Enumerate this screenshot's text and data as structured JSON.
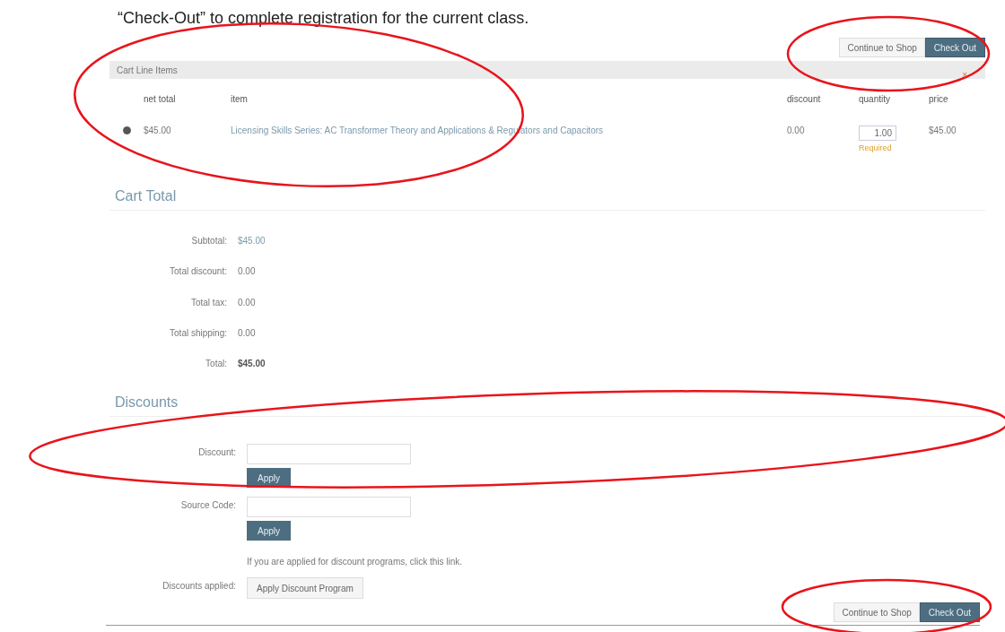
{
  "instruction": "“Check-Out” to complete registration for the current class.",
  "top_actions": [
    "Continue to Shop",
    "Check Out"
  ],
  "cart_line_items": {
    "title": "Cart Line Items",
    "remove_icon": "×",
    "columns": [
      "net total",
      "item",
      "discount",
      "quantity",
      "price"
    ],
    "rows": [
      {
        "selected": true,
        "net_total": "$45.00",
        "item": "Licensing Skills Series: AC Transformer Theory and Applications & Regulators and Capacitors",
        "discount": "0.00",
        "quantity": "1.00",
        "note": "Required",
        "price": "$45.00"
      }
    ]
  },
  "cart_total": {
    "title": "Cart Total",
    "rows": [
      {
        "label": "Subtotal:",
        "value": "$45.00",
        "kind": "link"
      },
      {
        "label": "Total discount:",
        "value": "0.00",
        "kind": "plain"
      },
      {
        "label": "Total tax:",
        "value": "0.00",
        "kind": "plain"
      },
      {
        "label": "Total shipping:",
        "value": "0.00",
        "kind": "plain"
      },
      {
        "label": "Total:",
        "value": "$45.00",
        "kind": "bold"
      }
    ]
  },
  "discounts": {
    "title": "Discounts",
    "fields": [
      {
        "label": "Discount:",
        "button": "Apply"
      },
      {
        "label": "Source Code:",
        "button": "Apply"
      }
    ],
    "note": "If you are applied for discount programs, click this link.",
    "applied_label": "Discounts applied:",
    "applied_button": "Apply Discount Program"
  },
  "bottom_actions": [
    "Continue to Shop",
    "Check Out"
  ],
  "annotations": [
    {
      "kind": "ellipse"
    },
    {
      "kind": "ellipse"
    },
    {
      "kind": "ellipse"
    },
    {
      "kind": "ellipse"
    }
  ]
}
